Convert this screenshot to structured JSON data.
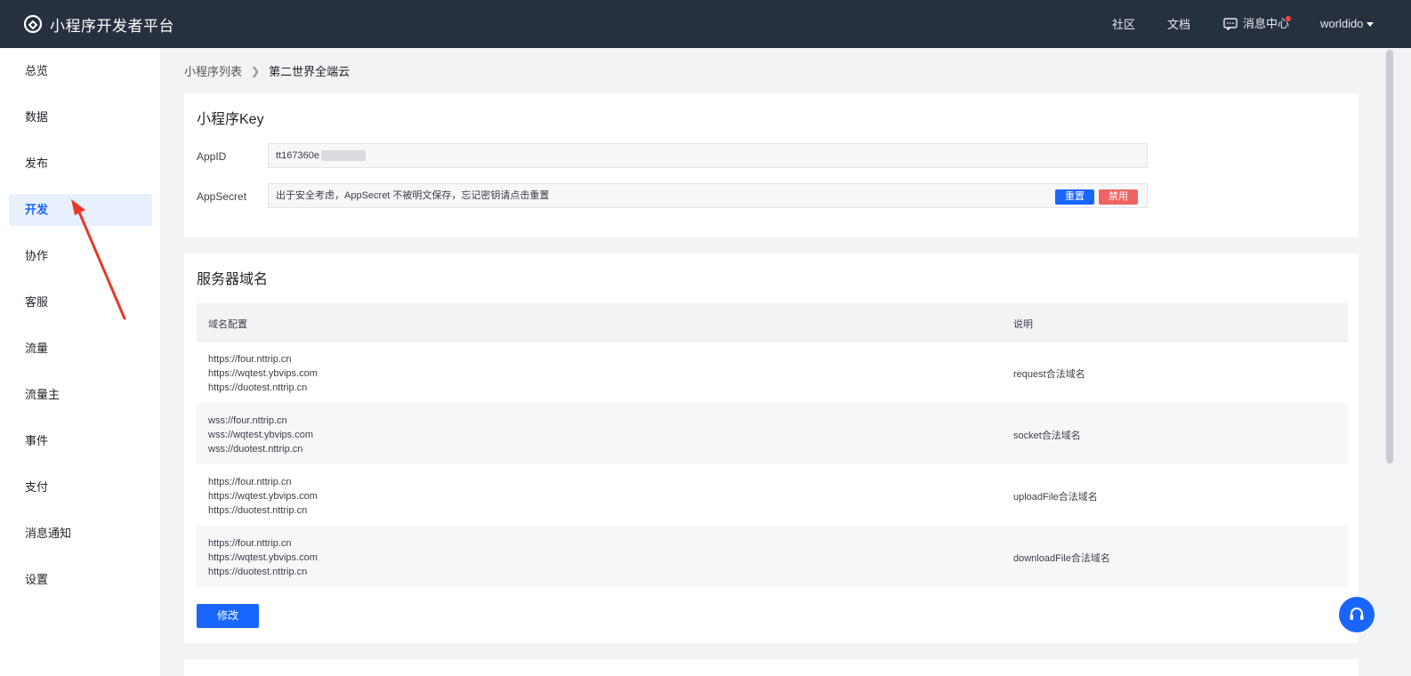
{
  "topbar": {
    "title": "小程序开发者平台",
    "links": {
      "community": "社区",
      "docs": "文档",
      "messages": "消息中心"
    },
    "user": "worldido"
  },
  "sidebar": {
    "items": [
      {
        "label": "总览"
      },
      {
        "label": "数据"
      },
      {
        "label": "发布"
      },
      {
        "label": "开发",
        "active": true
      },
      {
        "label": "协作"
      },
      {
        "label": "客服"
      },
      {
        "label": "流量"
      },
      {
        "label": "流量主"
      },
      {
        "label": "事件"
      },
      {
        "label": "支付"
      },
      {
        "label": "消息通知"
      },
      {
        "label": "设置"
      }
    ]
  },
  "breadcrumb": {
    "parent": "小程序列表",
    "current": "第二世界全端云"
  },
  "key_card": {
    "title": "小程序Key",
    "appid_label": "AppID",
    "appid_value": "tt167360e",
    "secret_label": "AppSecret",
    "secret_note": "出于安全考虑，AppSecret 不被明文保存，忘记密钥请点击重置",
    "reset_label": "重置",
    "disable_label": "禁用"
  },
  "domain_card": {
    "title": "服务器域名",
    "columns": [
      "域名配置",
      "说明"
    ],
    "rows": [
      {
        "urls": [
          "https://four.nttrip.cn",
          "https://wqtest.ybvips.com",
          "https://duotest.nttrip.cn"
        ],
        "desc": "request合法域名"
      },
      {
        "urls": [
          "wss://four.nttrip.cn",
          "wss://wqtest.ybvips.com",
          "wss://duotest.nttrip.cn"
        ],
        "desc": "socket合法域名"
      },
      {
        "urls": [
          "https://four.nttrip.cn",
          "https://wqtest.ybvips.com",
          "https://duotest.nttrip.cn"
        ],
        "desc": "uploadFile合法域名"
      },
      {
        "urls": [
          "https://four.nttrip.cn",
          "https://wqtest.ybvips.com",
          "https://duotest.nttrip.cn"
        ],
        "desc": "downloadFile合法域名"
      }
    ],
    "edit_label": "修改"
  },
  "colors": {
    "topbar": "#27303f",
    "accent": "#1966ff",
    "danger": "#f06363",
    "annotation_arrow": "#e8392b"
  }
}
